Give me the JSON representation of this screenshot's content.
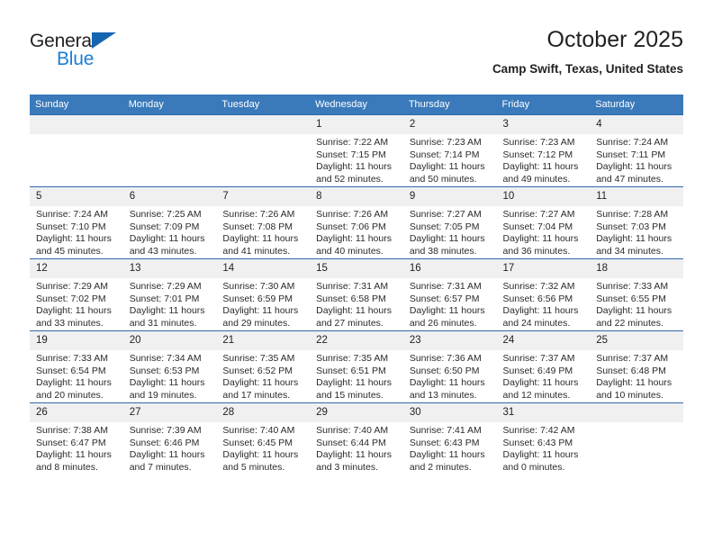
{
  "logo": {
    "word_top": "General",
    "word_bottom": "Blue",
    "triangle_color": "#1565b0",
    "blue_color": "#1a7fd4"
  },
  "header": {
    "title": "October 2025",
    "subtitle": "Camp Swift, Texas, United States"
  },
  "theme": {
    "header_row_bg": "#3a79ba",
    "header_row_text": "#ffffff",
    "daynum_bg": "#f0f0f0",
    "cell_border": "#2f6aab"
  },
  "calendar": {
    "weekday_headers": [
      "Sunday",
      "Monday",
      "Tuesday",
      "Wednesday",
      "Thursday",
      "Friday",
      "Saturday"
    ],
    "weeks": [
      [
        {
          "day": "",
          "sunrise": "",
          "sunset": "",
          "daylight_line1": "",
          "daylight_line2": "",
          "blank": true
        },
        {
          "day": "",
          "sunrise": "",
          "sunset": "",
          "daylight_line1": "",
          "daylight_line2": "",
          "blank": true
        },
        {
          "day": "",
          "sunrise": "",
          "sunset": "",
          "daylight_line1": "",
          "daylight_line2": "",
          "blank": true
        },
        {
          "day": "1",
          "sunrise": "Sunrise: 7:22 AM",
          "sunset": "Sunset: 7:15 PM",
          "daylight_line1": "Daylight: 11 hours",
          "daylight_line2": "and 52 minutes."
        },
        {
          "day": "2",
          "sunrise": "Sunrise: 7:23 AM",
          "sunset": "Sunset: 7:14 PM",
          "daylight_line1": "Daylight: 11 hours",
          "daylight_line2": "and 50 minutes."
        },
        {
          "day": "3",
          "sunrise": "Sunrise: 7:23 AM",
          "sunset": "Sunset: 7:12 PM",
          "daylight_line1": "Daylight: 11 hours",
          "daylight_line2": "and 49 minutes."
        },
        {
          "day": "4",
          "sunrise": "Sunrise: 7:24 AM",
          "sunset": "Sunset: 7:11 PM",
          "daylight_line1": "Daylight: 11 hours",
          "daylight_line2": "and 47 minutes."
        }
      ],
      [
        {
          "day": "5",
          "sunrise": "Sunrise: 7:24 AM",
          "sunset": "Sunset: 7:10 PM",
          "daylight_line1": "Daylight: 11 hours",
          "daylight_line2": "and 45 minutes."
        },
        {
          "day": "6",
          "sunrise": "Sunrise: 7:25 AM",
          "sunset": "Sunset: 7:09 PM",
          "daylight_line1": "Daylight: 11 hours",
          "daylight_line2": "and 43 minutes."
        },
        {
          "day": "7",
          "sunrise": "Sunrise: 7:26 AM",
          "sunset": "Sunset: 7:08 PM",
          "daylight_line1": "Daylight: 11 hours",
          "daylight_line2": "and 41 minutes."
        },
        {
          "day": "8",
          "sunrise": "Sunrise: 7:26 AM",
          "sunset": "Sunset: 7:06 PM",
          "daylight_line1": "Daylight: 11 hours",
          "daylight_line2": "and 40 minutes."
        },
        {
          "day": "9",
          "sunrise": "Sunrise: 7:27 AM",
          "sunset": "Sunset: 7:05 PM",
          "daylight_line1": "Daylight: 11 hours",
          "daylight_line2": "and 38 minutes."
        },
        {
          "day": "10",
          "sunrise": "Sunrise: 7:27 AM",
          "sunset": "Sunset: 7:04 PM",
          "daylight_line1": "Daylight: 11 hours",
          "daylight_line2": "and 36 minutes."
        },
        {
          "day": "11",
          "sunrise": "Sunrise: 7:28 AM",
          "sunset": "Sunset: 7:03 PM",
          "daylight_line1": "Daylight: 11 hours",
          "daylight_line2": "and 34 minutes."
        }
      ],
      [
        {
          "day": "12",
          "sunrise": "Sunrise: 7:29 AM",
          "sunset": "Sunset: 7:02 PM",
          "daylight_line1": "Daylight: 11 hours",
          "daylight_line2": "and 33 minutes."
        },
        {
          "day": "13",
          "sunrise": "Sunrise: 7:29 AM",
          "sunset": "Sunset: 7:01 PM",
          "daylight_line1": "Daylight: 11 hours",
          "daylight_line2": "and 31 minutes."
        },
        {
          "day": "14",
          "sunrise": "Sunrise: 7:30 AM",
          "sunset": "Sunset: 6:59 PM",
          "daylight_line1": "Daylight: 11 hours",
          "daylight_line2": "and 29 minutes."
        },
        {
          "day": "15",
          "sunrise": "Sunrise: 7:31 AM",
          "sunset": "Sunset: 6:58 PM",
          "daylight_line1": "Daylight: 11 hours",
          "daylight_line2": "and 27 minutes."
        },
        {
          "day": "16",
          "sunrise": "Sunrise: 7:31 AM",
          "sunset": "Sunset: 6:57 PM",
          "daylight_line1": "Daylight: 11 hours",
          "daylight_line2": "and 26 minutes."
        },
        {
          "day": "17",
          "sunrise": "Sunrise: 7:32 AM",
          "sunset": "Sunset: 6:56 PM",
          "daylight_line1": "Daylight: 11 hours",
          "daylight_line2": "and 24 minutes."
        },
        {
          "day": "18",
          "sunrise": "Sunrise: 7:33 AM",
          "sunset": "Sunset: 6:55 PM",
          "daylight_line1": "Daylight: 11 hours",
          "daylight_line2": "and 22 minutes."
        }
      ],
      [
        {
          "day": "19",
          "sunrise": "Sunrise: 7:33 AM",
          "sunset": "Sunset: 6:54 PM",
          "daylight_line1": "Daylight: 11 hours",
          "daylight_line2": "and 20 minutes."
        },
        {
          "day": "20",
          "sunrise": "Sunrise: 7:34 AM",
          "sunset": "Sunset: 6:53 PM",
          "daylight_line1": "Daylight: 11 hours",
          "daylight_line2": "and 19 minutes."
        },
        {
          "day": "21",
          "sunrise": "Sunrise: 7:35 AM",
          "sunset": "Sunset: 6:52 PM",
          "daylight_line1": "Daylight: 11 hours",
          "daylight_line2": "and 17 minutes."
        },
        {
          "day": "22",
          "sunrise": "Sunrise: 7:35 AM",
          "sunset": "Sunset: 6:51 PM",
          "daylight_line1": "Daylight: 11 hours",
          "daylight_line2": "and 15 minutes."
        },
        {
          "day": "23",
          "sunrise": "Sunrise: 7:36 AM",
          "sunset": "Sunset: 6:50 PM",
          "daylight_line1": "Daylight: 11 hours",
          "daylight_line2": "and 13 minutes."
        },
        {
          "day": "24",
          "sunrise": "Sunrise: 7:37 AM",
          "sunset": "Sunset: 6:49 PM",
          "daylight_line1": "Daylight: 11 hours",
          "daylight_line2": "and 12 minutes."
        },
        {
          "day": "25",
          "sunrise": "Sunrise: 7:37 AM",
          "sunset": "Sunset: 6:48 PM",
          "daylight_line1": "Daylight: 11 hours",
          "daylight_line2": "and 10 minutes."
        }
      ],
      [
        {
          "day": "26",
          "sunrise": "Sunrise: 7:38 AM",
          "sunset": "Sunset: 6:47 PM",
          "daylight_line1": "Daylight: 11 hours",
          "daylight_line2": "and 8 minutes."
        },
        {
          "day": "27",
          "sunrise": "Sunrise: 7:39 AM",
          "sunset": "Sunset: 6:46 PM",
          "daylight_line1": "Daylight: 11 hours",
          "daylight_line2": "and 7 minutes."
        },
        {
          "day": "28",
          "sunrise": "Sunrise: 7:40 AM",
          "sunset": "Sunset: 6:45 PM",
          "daylight_line1": "Daylight: 11 hours",
          "daylight_line2": "and 5 minutes."
        },
        {
          "day": "29",
          "sunrise": "Sunrise: 7:40 AM",
          "sunset": "Sunset: 6:44 PM",
          "daylight_line1": "Daylight: 11 hours",
          "daylight_line2": "and 3 minutes."
        },
        {
          "day": "30",
          "sunrise": "Sunrise: 7:41 AM",
          "sunset": "Sunset: 6:43 PM",
          "daylight_line1": "Daylight: 11 hours",
          "daylight_line2": "and 2 minutes."
        },
        {
          "day": "31",
          "sunrise": "Sunrise: 7:42 AM",
          "sunset": "Sunset: 6:43 PM",
          "daylight_line1": "Daylight: 11 hours",
          "daylight_line2": "and 0 minutes."
        },
        {
          "day": "",
          "sunrise": "",
          "sunset": "",
          "daylight_line1": "",
          "daylight_line2": "",
          "blank": true
        }
      ]
    ]
  }
}
